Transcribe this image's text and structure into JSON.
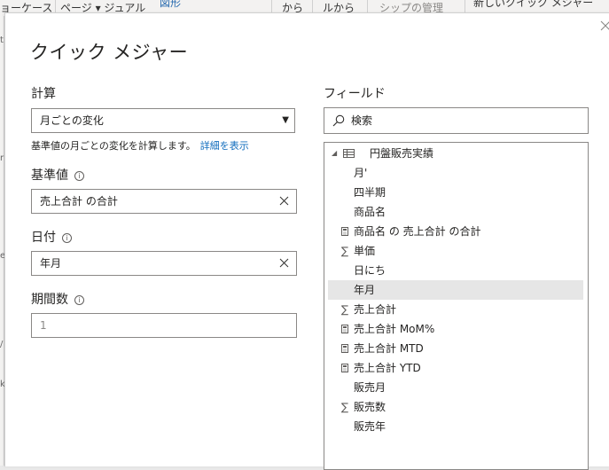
{
  "ribbon": {
    "items": [
      "ョーケース",
      "ページ ▾ ジュアル",
      "図形",
      "から",
      "ルから",
      "シップの管理",
      "新しいクイック メジャー"
    ]
  },
  "dialog": {
    "title": "クイック メジャー",
    "close_label": "×"
  },
  "calculation": {
    "label": "計算",
    "selected": "月ごとの変化",
    "description": "基準値の月ごとの変化を計算します。",
    "details_link": "詳細を表示"
  },
  "base_value": {
    "label": "基準値",
    "value": "売上合計 の合計"
  },
  "date": {
    "label": "日付",
    "value": "年月"
  },
  "periods": {
    "label": "期間数",
    "value": "1"
  },
  "fields": {
    "label": "フィールド",
    "search_placeholder": "検索",
    "table_name": "円盤販売実績",
    "items": [
      {
        "label": "月'",
        "icon": "none"
      },
      {
        "label": "四半期",
        "icon": "none"
      },
      {
        "label": "商品名",
        "icon": "none"
      },
      {
        "label": "商品名 の 売上合計 の合計",
        "icon": "calculator-icon"
      },
      {
        "label": "単価",
        "icon": "sigma-icon"
      },
      {
        "label": "日にち",
        "icon": "none"
      },
      {
        "label": "年月",
        "icon": "none",
        "selected": true
      },
      {
        "label": "売上合計",
        "icon": "sigma-icon"
      },
      {
        "label": "売上合計 MoM%",
        "icon": "calculator-icon"
      },
      {
        "label": "売上合計 MTD",
        "icon": "calculator-icon"
      },
      {
        "label": "売上合計 YTD",
        "icon": "calculator-icon"
      },
      {
        "label": "販売月",
        "icon": "none"
      },
      {
        "label": "販売数",
        "icon": "sigma-icon"
      },
      {
        "label": "販売年",
        "icon": "none"
      }
    ]
  }
}
